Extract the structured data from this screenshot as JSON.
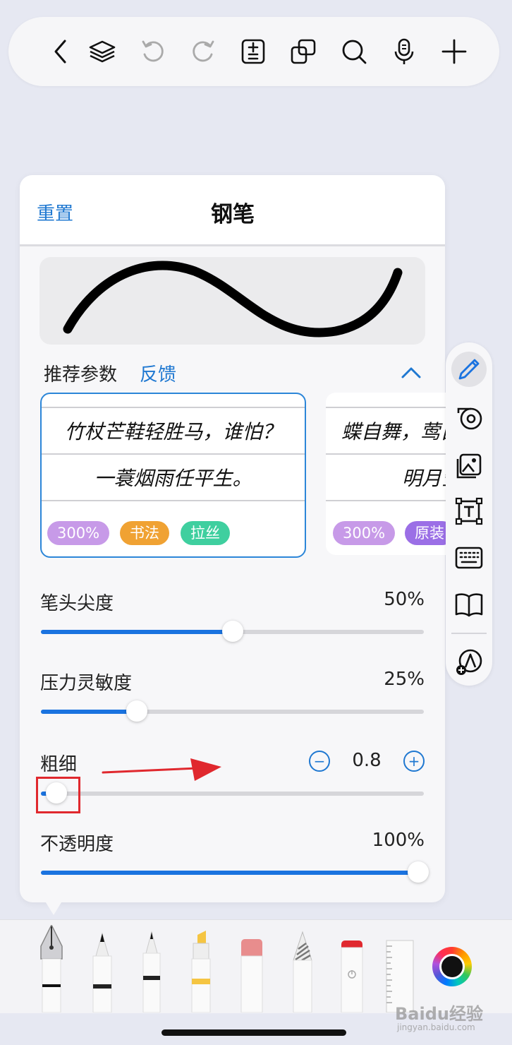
{
  "toolbar": {
    "icons": [
      "back-icon",
      "layers-icon",
      "undo-icon",
      "redo-icon",
      "page-add-icon",
      "duplicate-icon",
      "search-icon",
      "microphone-icon",
      "plus-icon"
    ]
  },
  "panel": {
    "reset_label": "重置",
    "title": "钢笔"
  },
  "recommended": {
    "label": "推荐参数",
    "feedback_label": "反馈",
    "cards": [
      {
        "lines": [
          "竹杖芒鞋轻胜马，谁怕？",
          "一蓑烟雨任平生。"
        ],
        "tags": [
          {
            "text": "300%",
            "color": "#c79ae8"
          },
          {
            "text": "书法",
            "color": "#f0a233"
          },
          {
            "text": "拉丝",
            "color": "#3fcf9f"
          }
        ]
      },
      {
        "lines": [
          "蝶自舞，莺自",
          "明月空"
        ],
        "tags": [
          {
            "text": "300%",
            "color": "#c79ae8"
          },
          {
            "text": "原装",
            "color": "#9b6fe6"
          }
        ]
      }
    ]
  },
  "sliders": {
    "tip_sharpness": {
      "label": "笔头尖度",
      "value_text": "50%",
      "value": 0.5
    },
    "pressure": {
      "label": "压力灵敏度",
      "value_text": "25%",
      "value": 0.25
    },
    "thickness": {
      "label": "粗细",
      "value_text": "0.8",
      "value": 0.04,
      "minus": "−",
      "plus": "+"
    },
    "opacity": {
      "label": "不透明度",
      "value_text": "100%",
      "value": 1.0
    }
  },
  "colors": {
    "accent": "#1a73e0",
    "link": "#1f78d1",
    "highlight": "#e0282e"
  },
  "sidebar": {
    "icons": [
      "pen-icon",
      "tape-icon",
      "image-icon",
      "text-box-icon",
      "keyboard-icon",
      "book-icon",
      "add-tool-icon"
    ]
  },
  "tray": {
    "tools": [
      "fountain-pen-tool",
      "pencil-tool",
      "fineliner-tool",
      "highlighter-tool",
      "eraser-tool",
      "pattern-pen-tool",
      "laser-pointer-tool",
      "ruler-tool"
    ],
    "color_picker": "color-palette"
  },
  "watermark": {
    "text": "Baidu经验",
    "sub": "jingyan.baidu.com"
  }
}
